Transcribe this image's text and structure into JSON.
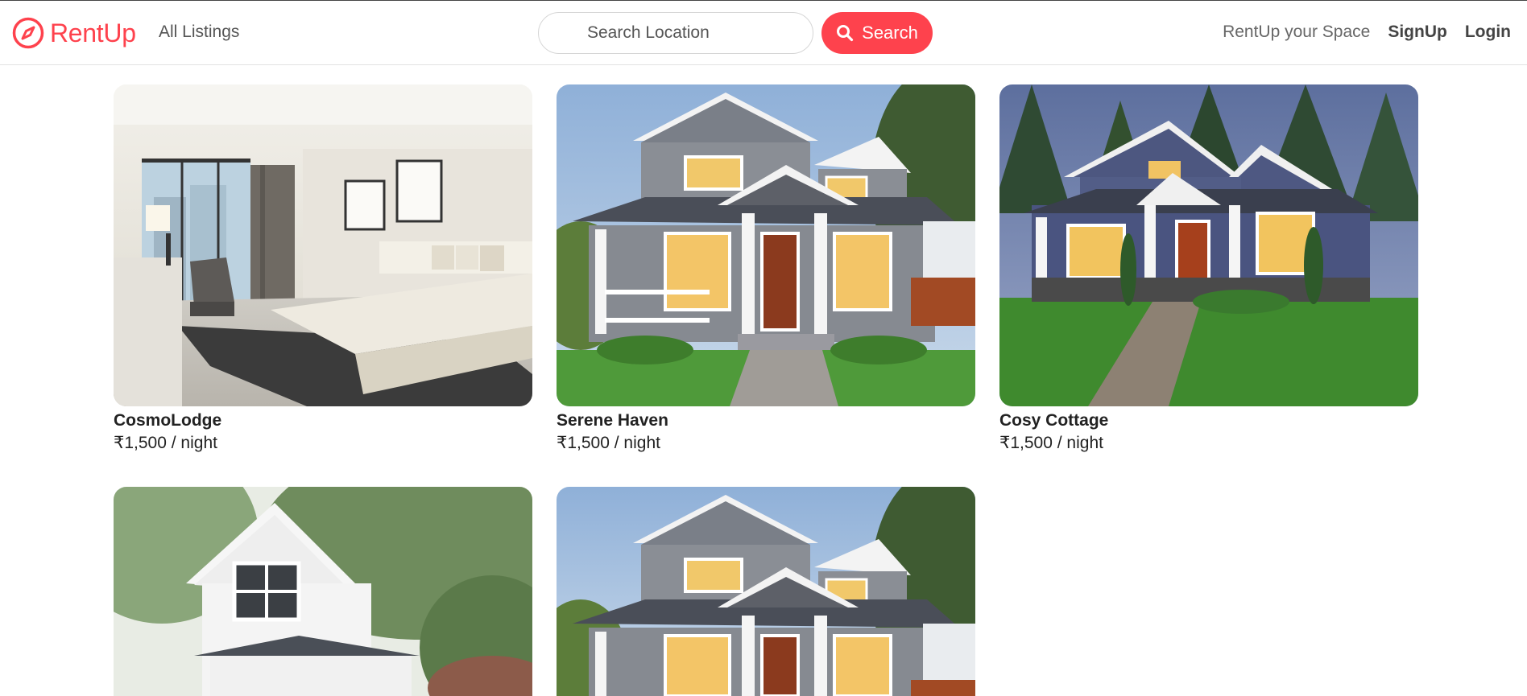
{
  "navbar": {
    "brand": "RentUp",
    "all_listings": "All Listings",
    "search_placeholder": "Search Location",
    "search_button": "Search",
    "rent_space": "RentUp your Space",
    "signup": "SignUp",
    "login": "Login"
  },
  "colors": {
    "brand": "#fe424d",
    "text": "#222222",
    "muted": "#666666"
  },
  "listings": [
    {
      "title": "CosmoLodge",
      "price": "₹1,500 / night",
      "image": "hotel-bedroom-photo"
    },
    {
      "title": "Serene Haven",
      "price": "₹1,500 / night",
      "image": "craftsman-house-photo"
    },
    {
      "title": "Cosy Cottage",
      "price": "₹1,500 / night",
      "image": "blue-cottage-photo"
    },
    {
      "title": "",
      "price": "",
      "image": "white-farmhouse-photo"
    },
    {
      "title": "",
      "price": "",
      "image": "craftsman-house-photo"
    }
  ]
}
